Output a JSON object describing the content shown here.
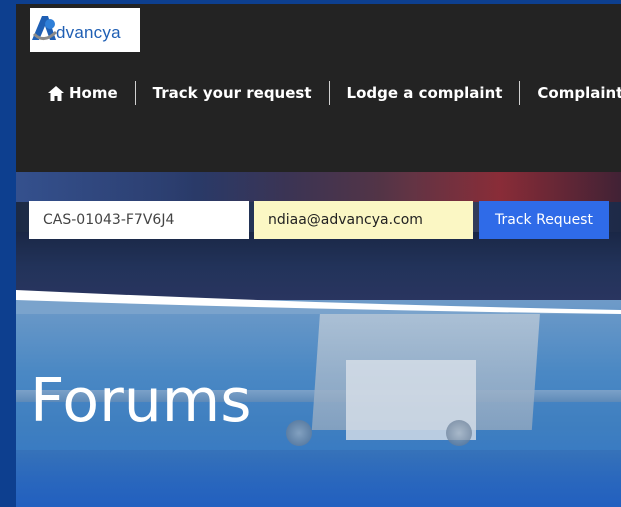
{
  "logo": {
    "text": "dvancya"
  },
  "nav": {
    "home": "Home",
    "items": [
      "Track your request",
      "Lodge a complaint",
      "Complaint"
    ]
  },
  "track": {
    "case_value": "CAS-01043-F7V6J4",
    "email_value": "ndiaa@advancya.com",
    "button_label": "Track Request"
  },
  "page": {
    "title": "Forums"
  },
  "colors": {
    "nav_bg": "#232323",
    "accent": "#2f6be8",
    "email_field_bg": "#fbf7c4",
    "outer_bg": "#0d3f8f"
  }
}
